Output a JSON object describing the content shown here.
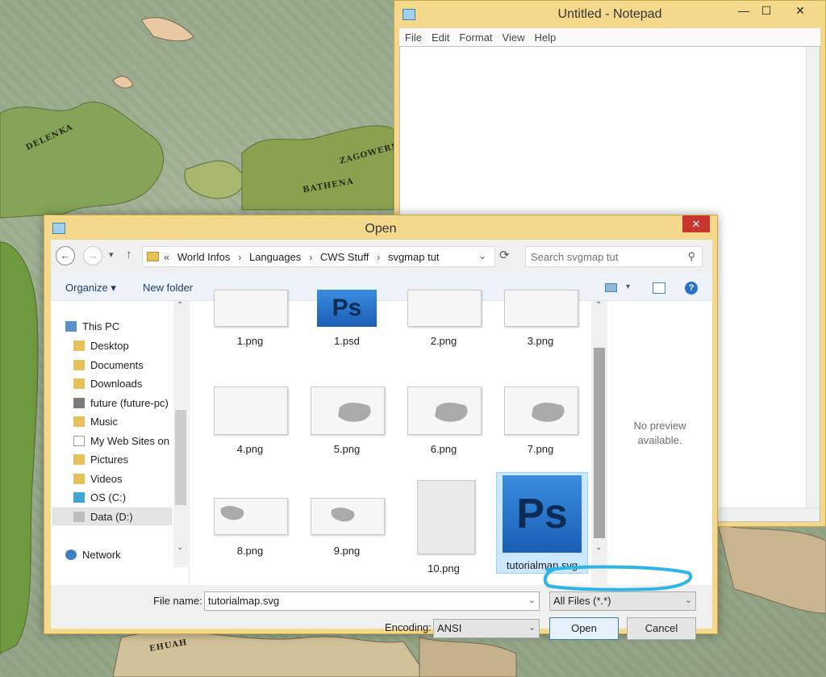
{
  "notepad": {
    "title": "Untitled - Notepad",
    "menu": [
      "File",
      "Edit",
      "Format",
      "View",
      "Help"
    ],
    "controls": {
      "minimize": "—",
      "maximize": "☐",
      "close": "✕"
    }
  },
  "dialog": {
    "title": "Open",
    "close": "✕",
    "nav": {
      "back": "←",
      "forward": "→",
      "dropdown": "▾",
      "up": "↑"
    },
    "breadcrumb": [
      "World Infos",
      "Languages",
      "CWS Stuff",
      "svgmap tut"
    ],
    "breadcrumb_prefix": "«",
    "search_placeholder": "Search svgmap tut",
    "toolbar": {
      "organize": "Organize ▾",
      "new_folder": "New folder",
      "help": "?"
    },
    "nav_items": [
      "This PC",
      "Desktop",
      "Documents",
      "Downloads",
      "future (future-pc)",
      "Music",
      "My Web Sites on",
      "Pictures",
      "Videos",
      "OS (C:)",
      "Data (D:)",
      "Network"
    ],
    "files": [
      "1.png",
      "1.psd",
      "2.png",
      "3.png",
      "4.png",
      "5.png",
      "6.png",
      "7.png",
      "8.png",
      "9.png",
      "10.png",
      "tutorialmap.svg"
    ],
    "ps_label": "Ps",
    "preview": {
      "line1": "No preview",
      "line2": "available."
    },
    "file_name_label": "File name:",
    "file_name_value": "tutorialmap.svg",
    "file_type": "All Files  (*.*)",
    "encoding_label": "Encoding:",
    "encoding_value": "ANSI",
    "open_button": "Open",
    "cancel_button": "Cancel"
  },
  "colors": {
    "titlebar": "#f4d88b",
    "close": "#c7372f",
    "highlight": "#2db5e6",
    "selection": "#cce8ff"
  }
}
